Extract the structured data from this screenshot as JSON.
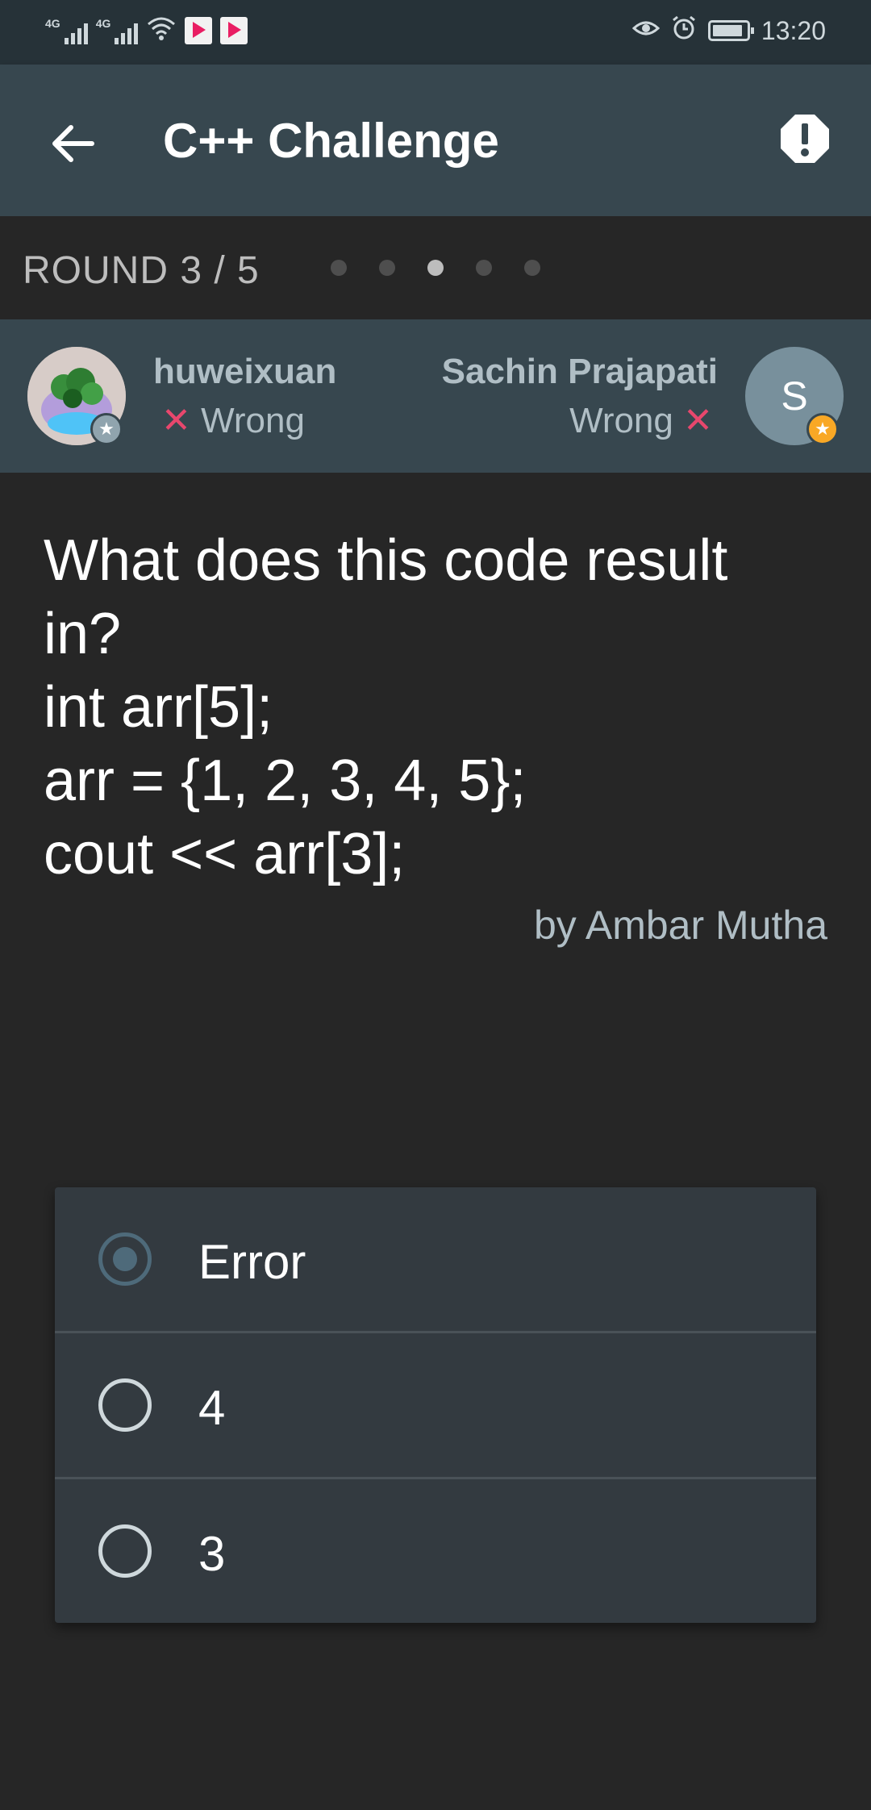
{
  "status_bar": {
    "signal1_label": "4G",
    "signal2_label": "4G",
    "time": "13:20",
    "icons": [
      "signal-icon",
      "signal-icon",
      "wifi-icon",
      "youku-app-icon",
      "youku-app-icon",
      "eye-comfort-icon",
      "alarm-icon",
      "battery-icon"
    ]
  },
  "app_bar": {
    "title": "C++ Challenge",
    "back_icon": "arrow-left-icon",
    "report_icon": "report-alert-icon"
  },
  "round": {
    "label": "ROUND 3 / 5",
    "current": 3,
    "total": 5
  },
  "players": {
    "left": {
      "name": "huweixuan",
      "status": "Wrong",
      "status_icon": "x-mark-icon",
      "badge_color": "#90a4ae"
    },
    "right": {
      "name": "Sachin Prajapati",
      "status": "Wrong",
      "status_icon": "x-mark-icon",
      "initial": "S",
      "badge_color": "#f9a825"
    }
  },
  "question": {
    "lines": [
      "What does this code result",
      "in?",
      "int arr[5];",
      "arr = {1, 2, 3, 4, 5};",
      "cout << arr[3];"
    ],
    "author": "by Ambar Mutha"
  },
  "answers": [
    {
      "label": "Error",
      "selected": true
    },
    {
      "label": "4",
      "selected": false
    },
    {
      "label": "3",
      "selected": false
    }
  ],
  "colors": {
    "background": "#262626",
    "app_bar": "#37474f",
    "wrong": "#e8476d",
    "card": "#333a40"
  }
}
